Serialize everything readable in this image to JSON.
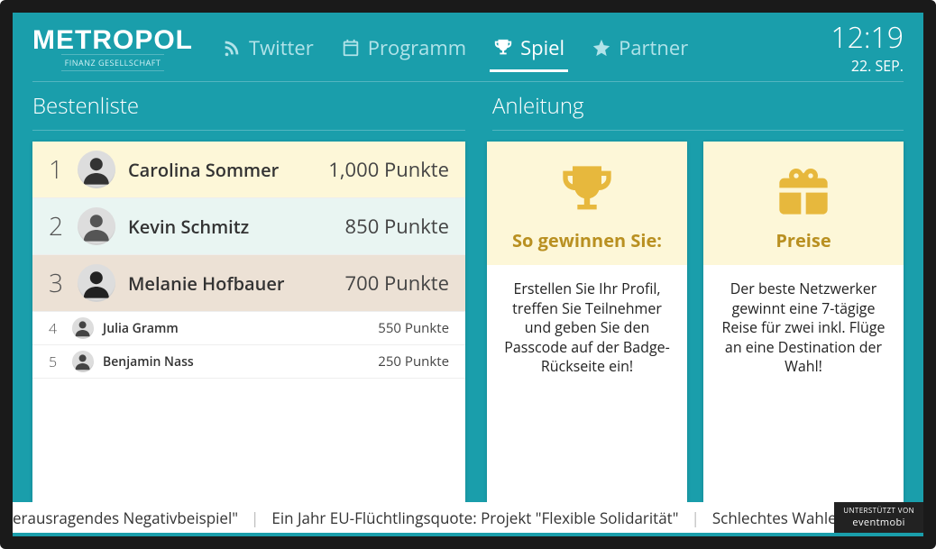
{
  "brand": {
    "name": "METROPOL",
    "subtitle": "FINANZ GESELLSCHAFT"
  },
  "tabs": [
    {
      "label": "Twitter"
    },
    {
      "label": "Programm"
    },
    {
      "label": "Spiel"
    },
    {
      "label": "Partner"
    }
  ],
  "active_tab_index": 2,
  "clock": {
    "time": "12:19",
    "date": "22. SEP."
  },
  "sections": {
    "leaderboard_title": "Bestenliste",
    "guide_title": "Anleitung"
  },
  "points_suffix": "Punkte",
  "leaderboard": [
    {
      "rank": "1",
      "name": "Carolina Sommer",
      "points": "1,000"
    },
    {
      "rank": "2",
      "name": "Kevin Schmitz",
      "points": "850"
    },
    {
      "rank": "3",
      "name": "Melanie Hofbauer",
      "points": "700"
    },
    {
      "rank": "4",
      "name": "Julia Gramm",
      "points": "550"
    },
    {
      "rank": "5",
      "name": "Benjamin Nass",
      "points": "250"
    }
  ],
  "cards": {
    "howto": {
      "title": "So gewinnen Sie:",
      "body": "Erstellen Sie Ihr Profil, treffen Sie Teilnehmer und geben Sie den Passcode auf der Badge-Rückseite ein!"
    },
    "prizes": {
      "title": "Preise",
      "body": "Der beste Netzwerker gewinnt eine 7-tägige Reise für zwei inkl. Flüge an eine Destination der Wahl!"
    }
  },
  "ticker": {
    "items": [
      "erausragendes Negativbeispiel\"",
      "Ein Jahr EU-Flüchtlingsquote: Projekt \"Flexible Solidarität\"",
      "Schlechtes Wahlerg"
    ]
  },
  "sponsor": {
    "supported_by": "UNTERSTÜTZT VON",
    "brand": "eventmobi"
  }
}
